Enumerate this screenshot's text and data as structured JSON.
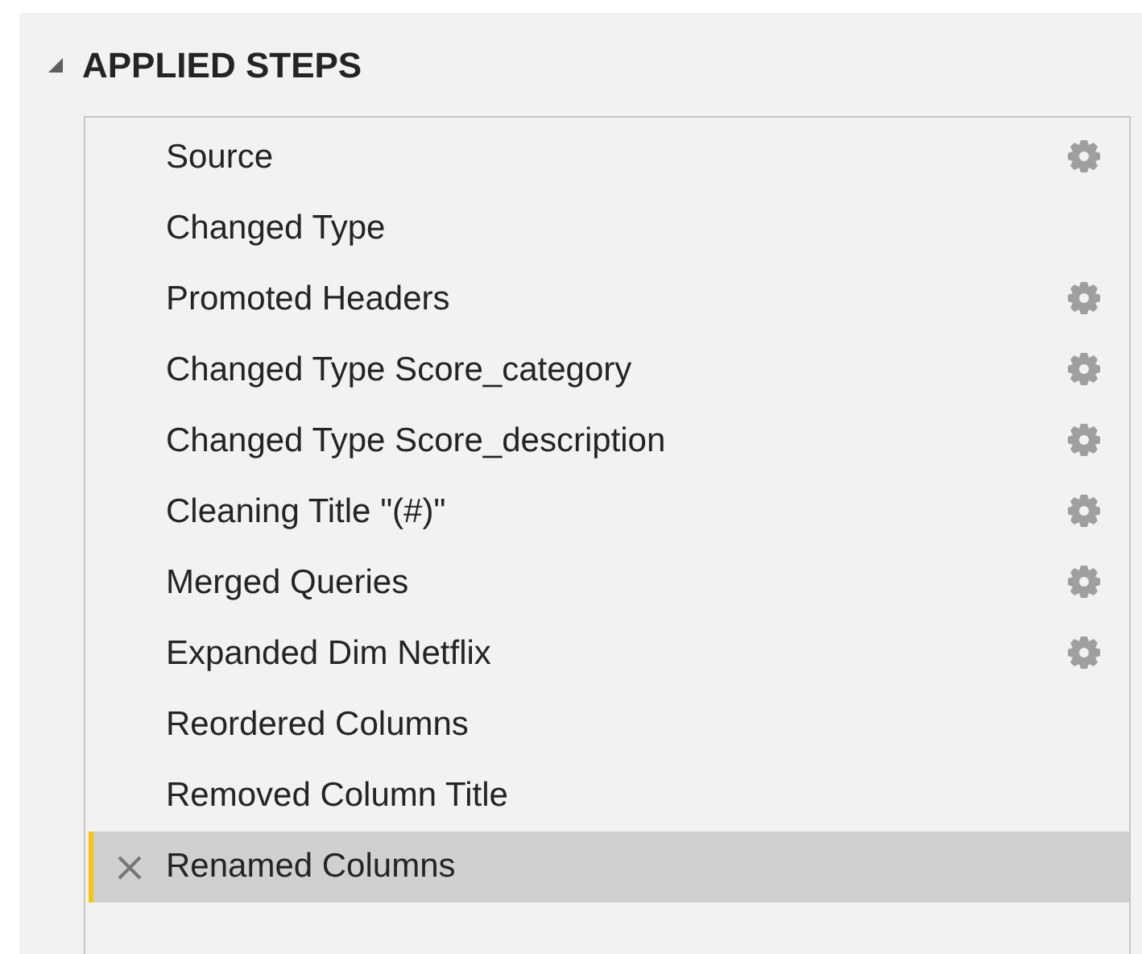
{
  "section": {
    "title": "APPLIED STEPS",
    "expanded": true
  },
  "steps": [
    {
      "label": "Source",
      "has_settings": true,
      "selected": false
    },
    {
      "label": "Changed Type",
      "has_settings": false,
      "selected": false
    },
    {
      "label": "Promoted Headers",
      "has_settings": true,
      "selected": false
    },
    {
      "label": "Changed Type Score_category",
      "has_settings": true,
      "selected": false
    },
    {
      "label": "Changed Type Score_description",
      "has_settings": true,
      "selected": false
    },
    {
      "label": "Cleaning Title \"(#)\"",
      "has_settings": true,
      "selected": false
    },
    {
      "label": "Merged Queries",
      "has_settings": true,
      "selected": false
    },
    {
      "label": "Expanded Dim Netflix",
      "has_settings": true,
      "selected": false
    },
    {
      "label": "Reordered Columns",
      "has_settings": false,
      "selected": false
    },
    {
      "label": "Removed Column Title",
      "has_settings": false,
      "selected": false
    },
    {
      "label": "Renamed Columns",
      "has_settings": false,
      "selected": true
    }
  ]
}
